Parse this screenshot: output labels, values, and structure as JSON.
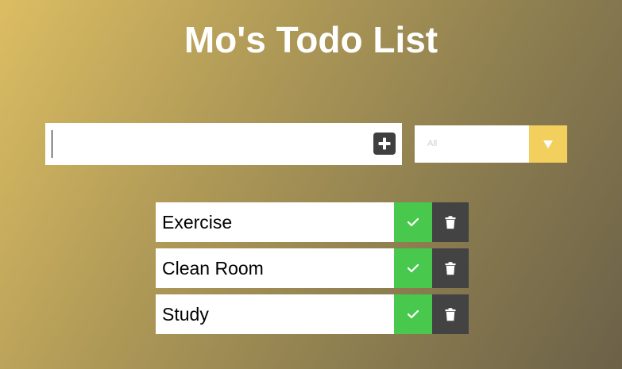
{
  "header": {
    "title": "Mo's Todo List"
  },
  "form": {
    "input_value": "",
    "add_icon": "plus-icon",
    "filter": {
      "selected": "All",
      "arrow_icon": "triangle-down-icon"
    }
  },
  "todos": [
    {
      "text": "Exercise",
      "complete_icon": "check-icon",
      "delete_icon": "trash-icon"
    },
    {
      "text": "Clean Room",
      "complete_icon": "check-icon",
      "delete_icon": "trash-icon"
    },
    {
      "text": "Study",
      "complete_icon": "check-icon",
      "delete_icon": "trash-icon"
    }
  ],
  "colors": {
    "complete_button": "#48c94d",
    "delete_button": "#434343",
    "filter_arrow_bg": "#f3cf5e",
    "add_button": "#3f3f3f",
    "title_text": "#ffffff"
  }
}
